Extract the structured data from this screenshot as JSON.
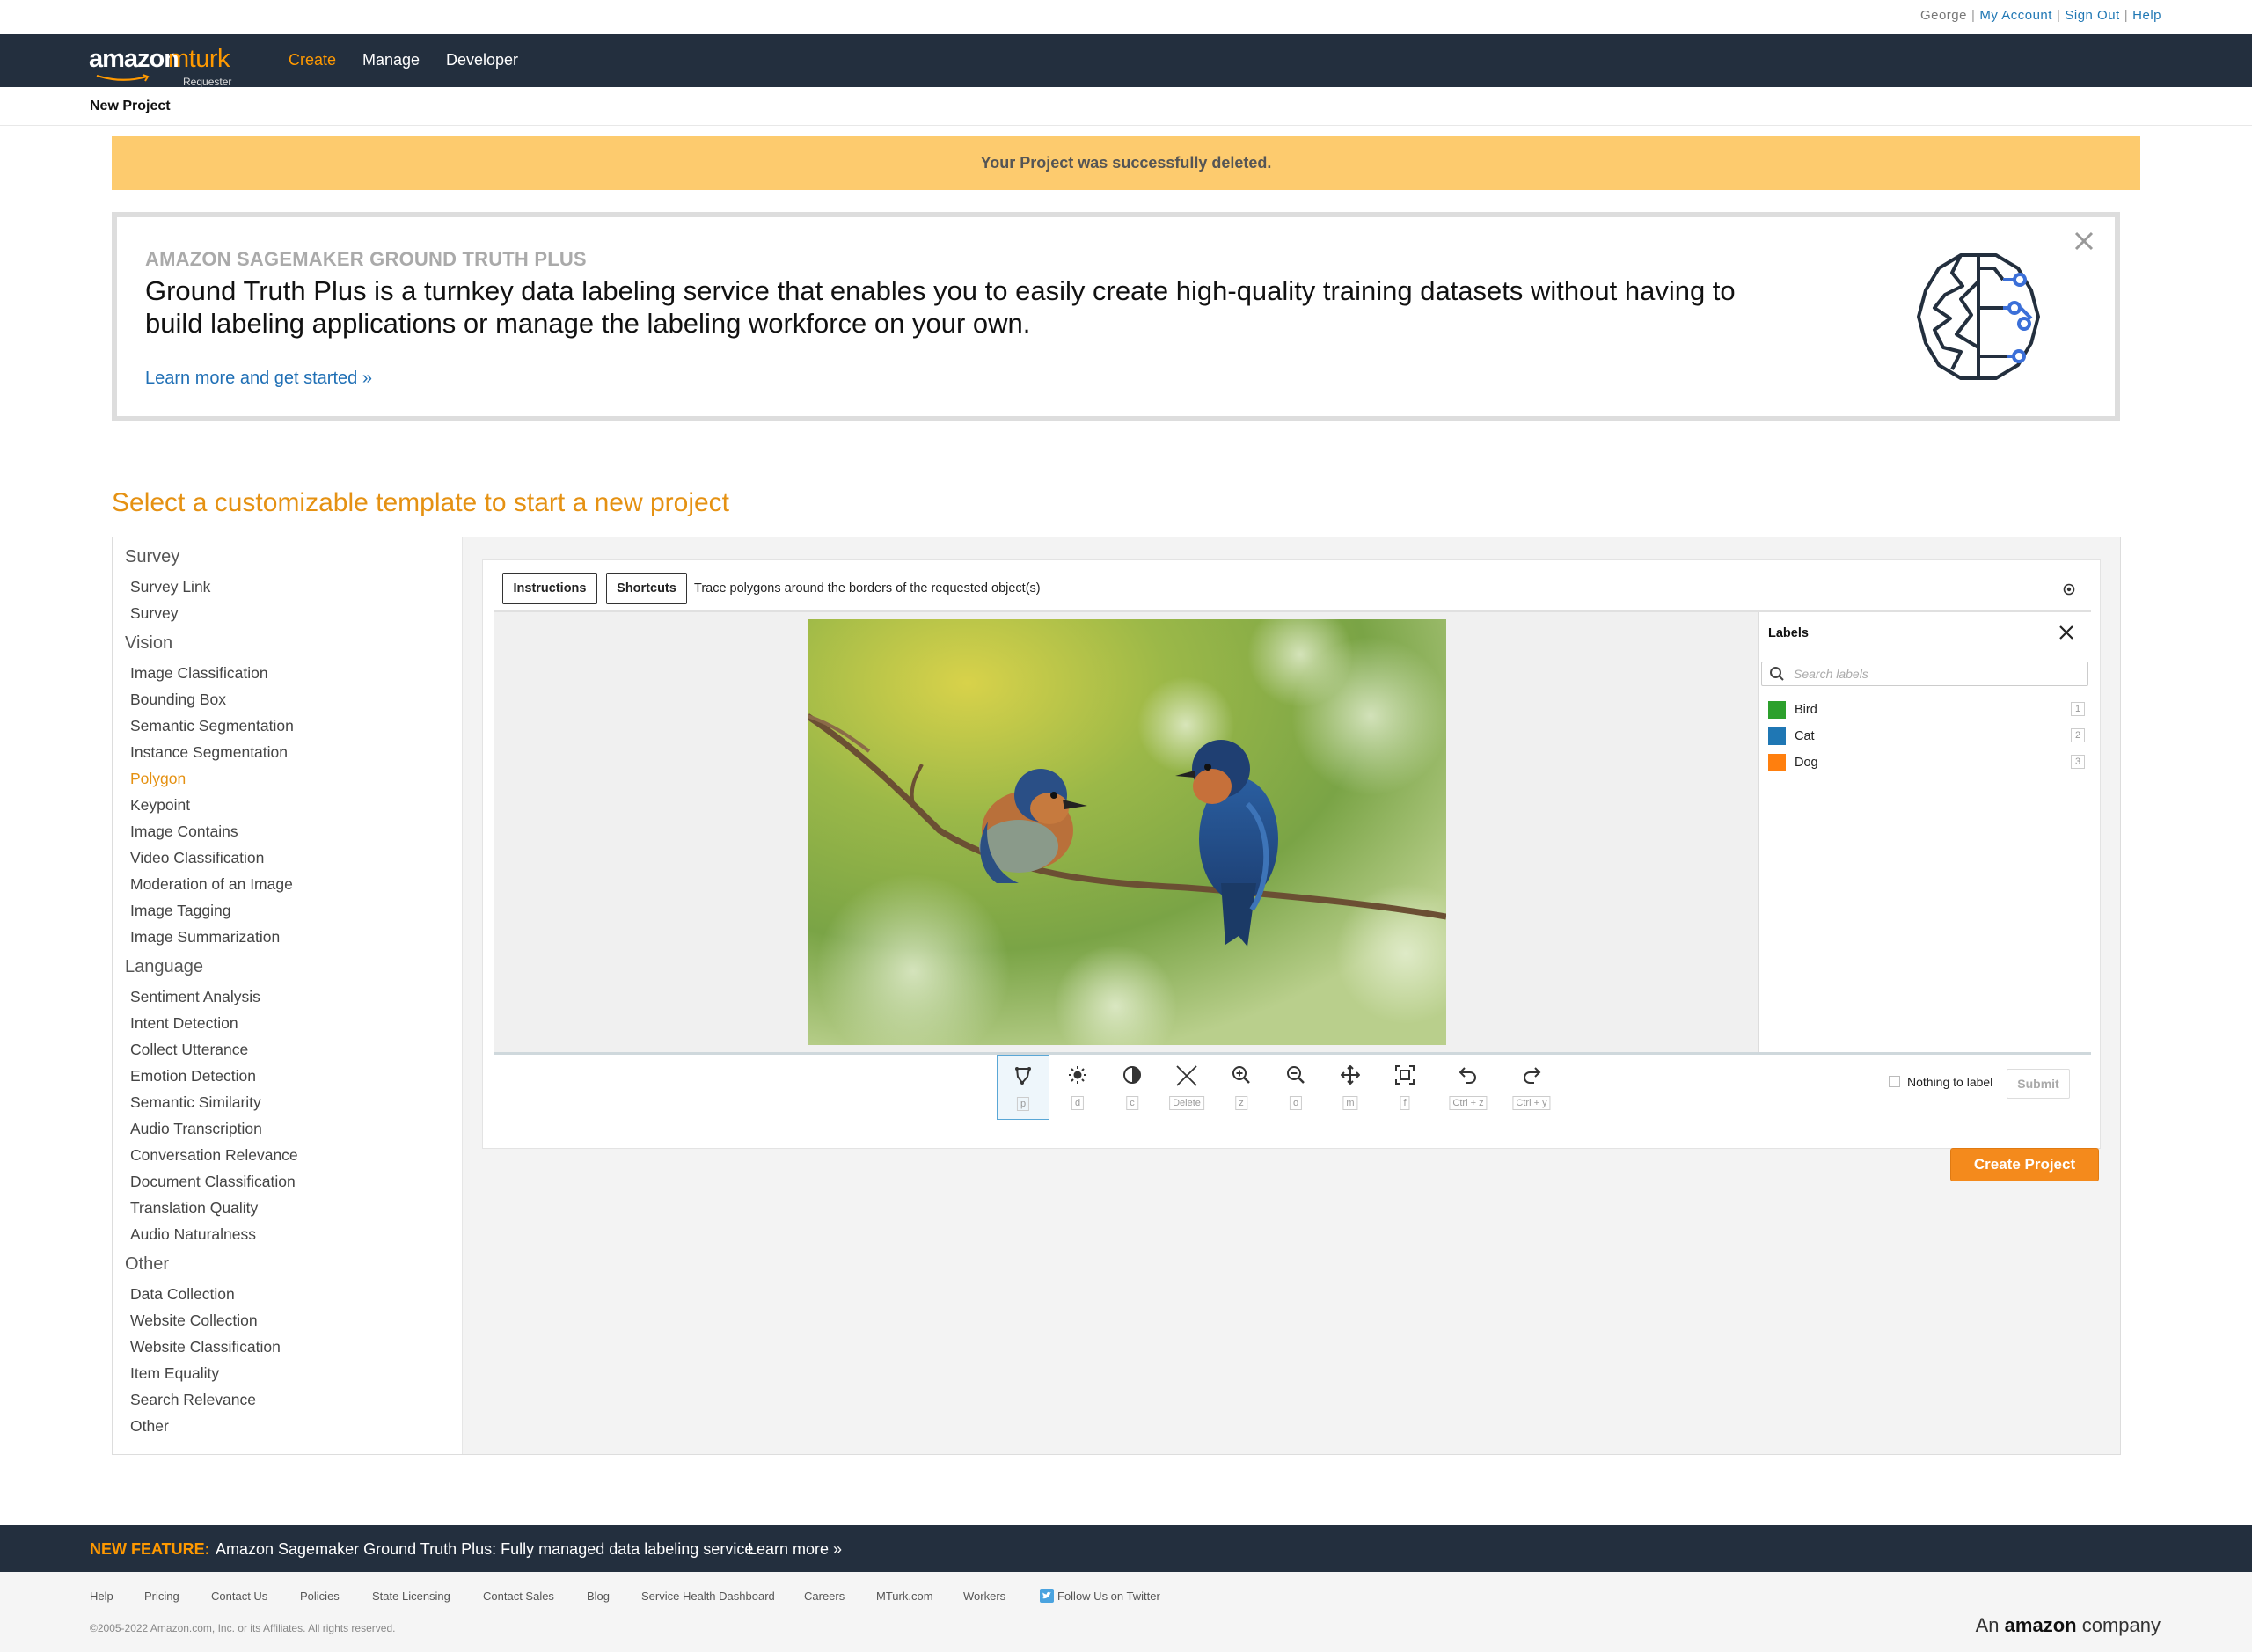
{
  "util": {
    "user": "George",
    "my_account": "My Account",
    "sign_out": "Sign Out",
    "help": "Help",
    "sep": "|"
  },
  "nav": {
    "logo_amazon": "amazon",
    "logo_mturk": "mturk",
    "logo_sub": "Requester",
    "items": [
      {
        "label": "Create",
        "active": true
      },
      {
        "label": "Manage",
        "active": false
      },
      {
        "label": "Developer",
        "active": false
      }
    ]
  },
  "page_title": "New Project",
  "alert": "Your Project was successfully deleted.",
  "promo": {
    "kicker": "AMAZON SAGEMAKER GROUND TRUTH PLUS",
    "headline": "Ground Truth Plus is a turnkey data labeling service that enables you to easily create high-quality training datasets without having to build labeling applications or manage the labeling workforce on your own.",
    "link": "Learn more and get started »",
    "close_icon": "close-icon",
    "brain_icon": "brain-circuit-icon"
  },
  "section_title": "Select a customizable template to start a new project",
  "sidebar": {
    "categories": [
      {
        "label": "Survey",
        "items": [
          {
            "label": "Survey Link"
          },
          {
            "label": "Survey"
          }
        ]
      },
      {
        "label": "Vision",
        "items": [
          {
            "label": "Image Classification"
          },
          {
            "label": "Bounding Box"
          },
          {
            "label": "Semantic Segmentation"
          },
          {
            "label": "Instance Segmentation"
          },
          {
            "label": "Polygon",
            "active": true
          },
          {
            "label": "Keypoint"
          },
          {
            "label": "Image Contains"
          },
          {
            "label": "Video Classification"
          },
          {
            "label": "Moderation of an Image"
          },
          {
            "label": "Image Tagging"
          },
          {
            "label": "Image Summarization"
          }
        ]
      },
      {
        "label": "Language",
        "items": [
          {
            "label": "Sentiment Analysis"
          },
          {
            "label": "Intent Detection"
          },
          {
            "label": "Collect Utterance"
          },
          {
            "label": "Emotion Detection"
          },
          {
            "label": "Semantic Similarity"
          },
          {
            "label": "Audio Transcription"
          },
          {
            "label": "Conversation Relevance"
          },
          {
            "label": "Document Classification"
          },
          {
            "label": "Translation Quality"
          },
          {
            "label": "Audio Naturalness"
          }
        ]
      },
      {
        "label": "Other",
        "items": [
          {
            "label": "Data Collection"
          },
          {
            "label": "Website Collection"
          },
          {
            "label": "Website Classification"
          },
          {
            "label": "Item Equality"
          },
          {
            "label": "Search Relevance"
          },
          {
            "label": "Other"
          }
        ]
      }
    ]
  },
  "preview": {
    "instructions_btn": "Instructions",
    "shortcuts_btn": "Shortcuts",
    "instruction_text": "Trace polygons around the borders of the requested object(s)",
    "labels_title": "Labels",
    "search_placeholder": "Search labels",
    "labels": [
      {
        "name": "Bird",
        "color": "#2ca02c",
        "key": "1"
      },
      {
        "name": "Cat",
        "color": "#1f77b4",
        "key": "2"
      },
      {
        "name": "Dog",
        "color": "#ff7f0e",
        "key": "3"
      }
    ],
    "tools": [
      {
        "icon": "polygon-icon",
        "key": "p",
        "selected": true
      },
      {
        "icon": "brightness-icon",
        "key": "d"
      },
      {
        "icon": "contrast-icon",
        "key": "c"
      },
      {
        "icon": "delete-icon",
        "key": "Delete"
      },
      {
        "icon": "zoom-in-icon",
        "key": "z"
      },
      {
        "icon": "zoom-out-icon",
        "key": "o"
      },
      {
        "icon": "move-icon",
        "key": "m"
      },
      {
        "icon": "fit-icon",
        "key": "f"
      },
      {
        "icon": "undo-icon",
        "key": "Ctrl + z"
      },
      {
        "icon": "redo-icon",
        "key": "Ctrl + y"
      }
    ],
    "nothing_to_label": "Nothing to label",
    "submit": "Submit"
  },
  "create_project": "Create Project",
  "feature": {
    "tag": "NEW FEATURE:",
    "text": "Amazon Sagemaker Ground Truth Plus: Fully managed data labeling service",
    "more": "Learn more »"
  },
  "footer": {
    "links": [
      {
        "label": "Help"
      },
      {
        "label": "Pricing"
      },
      {
        "label": "Contact Us"
      },
      {
        "label": "Policies"
      },
      {
        "label": "State Licensing"
      },
      {
        "label": "Contact Sales"
      },
      {
        "label": "Blog"
      },
      {
        "label": "Service Health Dashboard"
      },
      {
        "label": "Careers"
      },
      {
        "label": "MTurk.com"
      },
      {
        "label": "Workers"
      },
      {
        "label": "Follow Us on Twitter"
      }
    ],
    "copyright": "©2005-2022 Amazon.com, Inc. or its Affiliates. All rights reserved.",
    "an": "An",
    "amazon": "amazon",
    "company": "company"
  },
  "colors": {
    "nav_bg": "#232f3e",
    "accent_orange": "#f90",
    "section_orange": "#e59112",
    "alert_bg": "#fdcb6e",
    "link_blue": "#1f6fb5"
  }
}
